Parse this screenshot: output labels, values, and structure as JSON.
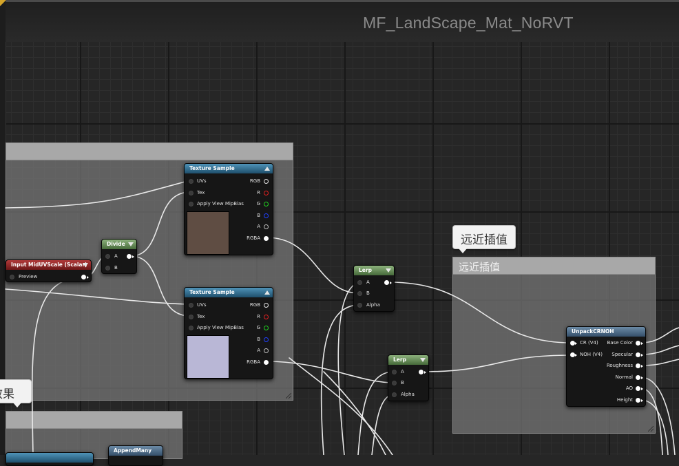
{
  "graph": {
    "title": "MF_LandScape_Mat_NoRVT"
  },
  "comments": {
    "left_top_title": "",
    "far_near_bubble": "远近插值",
    "far_near_title": "远近插值",
    "effect_bubble": "效果",
    "left_bottom_title": ""
  },
  "nodes": {
    "tex1": {
      "title": "Texture Sample",
      "inputs": [
        "UVs",
        "Tex",
        "Apply View MipBias"
      ],
      "outputs": [
        "RGB",
        "R",
        "G",
        "B",
        "A",
        "RGBA"
      ],
      "preview_color": "#5f4d43"
    },
    "tex2": {
      "title": "Texture Sample",
      "inputs": [
        "UVs",
        "Tex",
        "Apply View MipBias"
      ],
      "outputs": [
        "RGB",
        "R",
        "G",
        "B",
        "A",
        "RGBA"
      ],
      "preview_color": "#b9b7d6"
    },
    "divide": {
      "title": "Divide",
      "inputs": [
        "A",
        "B"
      ]
    },
    "param": {
      "title": "Input MidUVScale (Scalar)",
      "inputs": [
        "Preview"
      ]
    },
    "lerp1": {
      "title": "Lerp",
      "inputs": [
        "A",
        "B",
        "Alpha"
      ]
    },
    "lerp2": {
      "title": "Lerp",
      "inputs": [
        "A",
        "B",
        "Alpha"
      ]
    },
    "unpack": {
      "title": "UnpackCRNOH",
      "inputs": [
        "CR (V4)",
        "NOH (V4)"
      ],
      "outputs": [
        "Base Color",
        "Specular",
        "Roughness",
        "Normal",
        "AO",
        "Height"
      ]
    },
    "append": {
      "title": "AppendMany"
    }
  },
  "colors": {
    "texture_header": "#2a6a8e",
    "lerp_header": "#587e4a",
    "param_header": "#8a2020",
    "canvas": "#262626",
    "comment_header": "#a8a8a8"
  }
}
